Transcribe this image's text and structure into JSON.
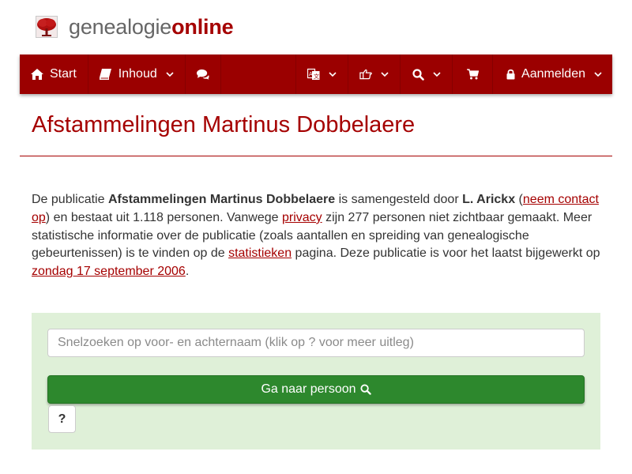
{
  "brand": {
    "part1": "genealogie",
    "part2": "online"
  },
  "nav": {
    "start_label": "Start",
    "inhoud_label": "Inhoud",
    "login_label": "Aanmelden",
    "icons": {
      "start": "home-icon",
      "inhoud": "book-icon",
      "chat": "comments-icon",
      "language": "language-icon",
      "share": "hand-point-icon",
      "search": "search-icon",
      "cart": "shopping-cart-icon",
      "login": "lock-icon"
    }
  },
  "title": "Afstammelingen Martinus Dobbelaere",
  "description": {
    "t1": "De publicatie ",
    "publication": "Afstammelingen Martinus Dobbelaere",
    "t2": " is samengesteld door ",
    "author": "L. Arickx",
    "t3": " (",
    "contact_link": "neem contact op",
    "t4": ") en bestaat uit 1.118 personen. Vanwege ",
    "privacy_link": "privacy",
    "t5": " zijn 277 personen niet zichtbaar gemaakt. Meer statistische informatie over de publicatie (zoals aantallen en spreiding van genealogische gebeurtenissen) is te vinden op de ",
    "stats_link": "statistieken",
    "t6": " pagina. Deze publicatie is voor het laatst bijgewerkt op ",
    "date_link": "zondag 17 september 2006",
    "t7": "."
  },
  "search": {
    "placeholder": "Snelzoeken op voor- en achternaam (klik op ? voor meer uitleg)",
    "go_label": "Ga naar persoon",
    "help_label": "?"
  },
  "colors": {
    "brand_red": "#9b0000",
    "title_red": "#a50000",
    "panel_green": "#dff0d8",
    "button_green": "#2d882d"
  }
}
